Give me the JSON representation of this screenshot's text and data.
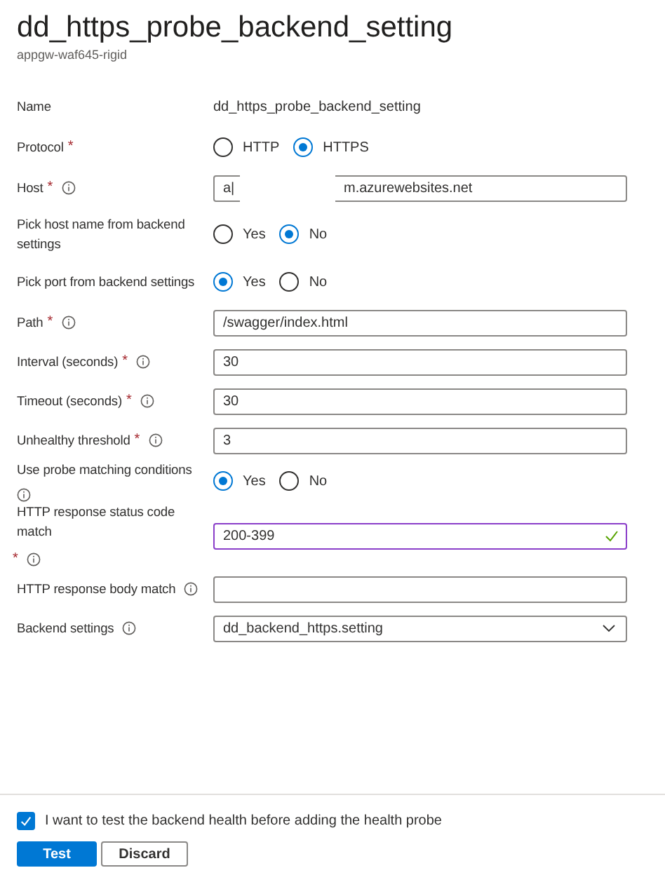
{
  "header": {
    "title": "dd_https_probe_backend_setting",
    "subtitle": "appgw-waf645-rigid"
  },
  "fields": [
    {
      "kind": "text",
      "label": "Name",
      "value": "dd_https_probe_backend_setting"
    },
    {
      "kind": "radio",
      "label": "Protocol",
      "required_mark": "*",
      "options": [
        {
          "label": "HTTP",
          "selected": false
        },
        {
          "label": "HTTPS",
          "selected": true
        }
      ]
    },
    {
      "kind": "redacted",
      "label": "Host",
      "required_mark": "*",
      "info": true,
      "value_start": "a|",
      "value_end": "m.azurewebsites.net"
    },
    {
      "kind": "radio",
      "label": "Pick host name from backend settings",
      "options": [
        {
          "label": "Yes",
          "selected": false
        },
        {
          "label": "No",
          "selected": true
        }
      ]
    },
    {
      "kind": "radio",
      "label": "Pick port from backend settings",
      "options": [
        {
          "label": "Yes",
          "selected": true
        },
        {
          "label": "No",
          "selected": false
        }
      ]
    },
    {
      "kind": "input",
      "label": "Path",
      "required_mark": "*",
      "info": true,
      "value": "/swagger/index.html",
      "validated": false
    },
    {
      "kind": "input",
      "label": "Interval (seconds)",
      "required_mark": "*",
      "info": true,
      "value": "30",
      "validated": false
    },
    {
      "kind": "input",
      "label": "Timeout (seconds)",
      "required_mark": "*",
      "info": true,
      "value": "30",
      "validated": false
    },
    {
      "kind": "input",
      "label": "Unhealthy threshold",
      "required_mark": "*",
      "info": true,
      "value": "3",
      "validated": false
    },
    {
      "kind": "radio",
      "label": "Use probe matching conditions",
      "info": true,
      "options": [
        {
          "label": "Yes",
          "selected": true
        },
        {
          "label": "No",
          "selected": false
        }
      ]
    },
    {
      "kind": "input",
      "label": "HTTP response status code match",
      "required_mark": "*",
      "info": true,
      "value": "200-399",
      "validated": true
    },
    {
      "kind": "input",
      "label": "HTTP response body match",
      "info": true,
      "validated": false
    },
    {
      "kind": "select",
      "label": "Backend settings",
      "info": true,
      "value": "dd_backend_https.setting"
    }
  ],
  "footer": {
    "checkbox": {
      "label": "I want to test the backend health before adding the health probe",
      "checked": true
    },
    "buttons": [
      {
        "label": "Test",
        "primary": true
      },
      {
        "label": "Discard",
        "primary": false
      }
    ]
  }
}
